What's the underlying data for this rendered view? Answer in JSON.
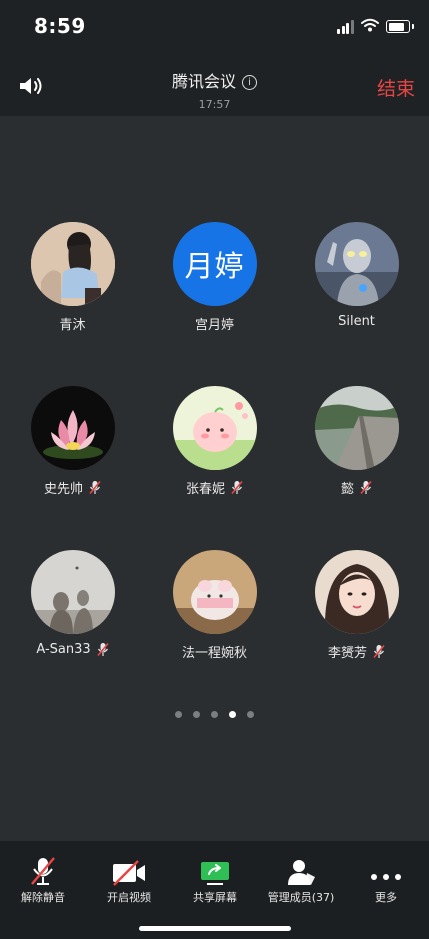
{
  "status": {
    "time": "8:59"
  },
  "header": {
    "title": "腾讯会议",
    "duration": "17:57",
    "end_label": "结束"
  },
  "participants": [
    {
      "name": "青沐",
      "muted": false
    },
    {
      "name": "宫月婷",
      "avatar_text": "月婷",
      "muted": false
    },
    {
      "name": "Silent",
      "muted": false
    },
    {
      "name": "史先帅",
      "muted": true
    },
    {
      "name": "张春妮",
      "muted": true
    },
    {
      "name": "懿",
      "muted": true
    },
    {
      "name": "A-San33",
      "muted": true
    },
    {
      "name": "法一程婉秋",
      "muted": false
    },
    {
      "name": "李赟芳",
      "muted": true
    }
  ],
  "pagination": {
    "pages": 5,
    "current": 4
  },
  "toolbar": {
    "unmute_label": "解除静音",
    "video_label": "开启视频",
    "share_label": "共享屏幕",
    "members_label": "管理成员(37)",
    "more_label": "更多"
  },
  "colors": {
    "accent_red": "#e84545",
    "share_green": "#2fbf55",
    "avatar_blue": "#1774e6"
  }
}
